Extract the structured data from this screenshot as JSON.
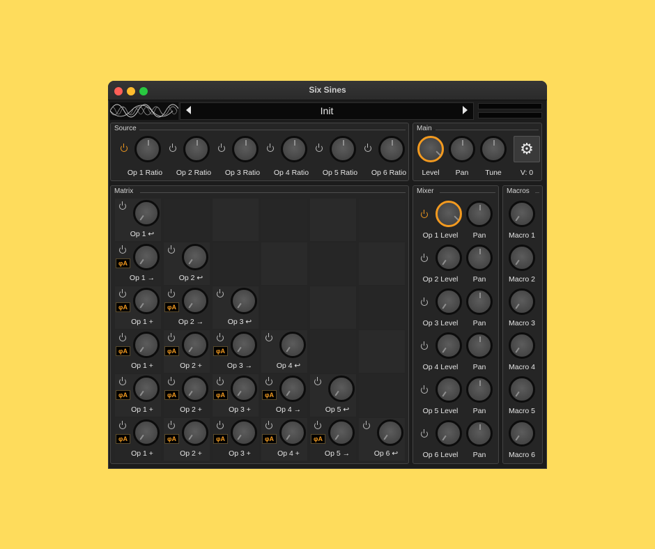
{
  "window": {
    "title": "Six Sines"
  },
  "preset": {
    "name": "Init"
  },
  "source": {
    "title": "Source",
    "items": [
      {
        "label": "Op 1 Ratio",
        "power_on": true
      },
      {
        "label": "Op 2 Ratio",
        "power_on": false
      },
      {
        "label": "Op 3 Ratio",
        "power_on": false
      },
      {
        "label": "Op 4 Ratio",
        "power_on": false
      },
      {
        "label": "Op 5 Ratio",
        "power_on": false
      },
      {
        "label": "Op 6 Ratio",
        "power_on": false
      }
    ]
  },
  "main": {
    "title": "Main",
    "level_label": "Level",
    "pan_label": "Pan",
    "tune_label": "Tune",
    "voices_label": "V: 0",
    "settings_icon": "gear-icon"
  },
  "matrix": {
    "title": "Matrix",
    "phase_badge": "φA",
    "rows": [
      [
        "Op 1 ↩"
      ],
      [
        "Op 1 →",
        "Op 2 ↩"
      ],
      [
        "Op 1 +",
        "Op 2 →",
        "Op 3 ↩"
      ],
      [
        "Op 1 +",
        "Op 2 +",
        "Op 3 →",
        "Op 4 ↩"
      ],
      [
        "Op 1 +",
        "Op 2 +",
        "Op 3 +",
        "Op 4 →",
        "Op 5 ↩"
      ],
      [
        "Op 1 +",
        "Op 2 +",
        "Op 3 +",
        "Op 4 +",
        "Op 5 →",
        "Op 6 ↩"
      ]
    ]
  },
  "mixer": {
    "title": "Mixer",
    "rows": [
      {
        "level_label": "Op 1 Level",
        "pan_label": "Pan",
        "power_on": true
      },
      {
        "level_label": "Op 2 Level",
        "pan_label": "Pan",
        "power_on": false
      },
      {
        "level_label": "Op 3 Level",
        "pan_label": "Pan",
        "power_on": false
      },
      {
        "level_label": "Op 4 Level",
        "pan_label": "Pan",
        "power_on": false
      },
      {
        "level_label": "Op 5 Level",
        "pan_label": "Pan",
        "power_on": false
      },
      {
        "level_label": "Op 6 Level",
        "pan_label": "Pan",
        "power_on": false
      }
    ]
  },
  "macros": {
    "title": "Macros",
    "items": [
      "Macro 1",
      "Macro 2",
      "Macro 3",
      "Macro 4",
      "Macro 5",
      "Macro 6"
    ]
  },
  "colors": {
    "accent": "#f39a1f",
    "background": "#fedc5c",
    "panel": "#252525"
  }
}
